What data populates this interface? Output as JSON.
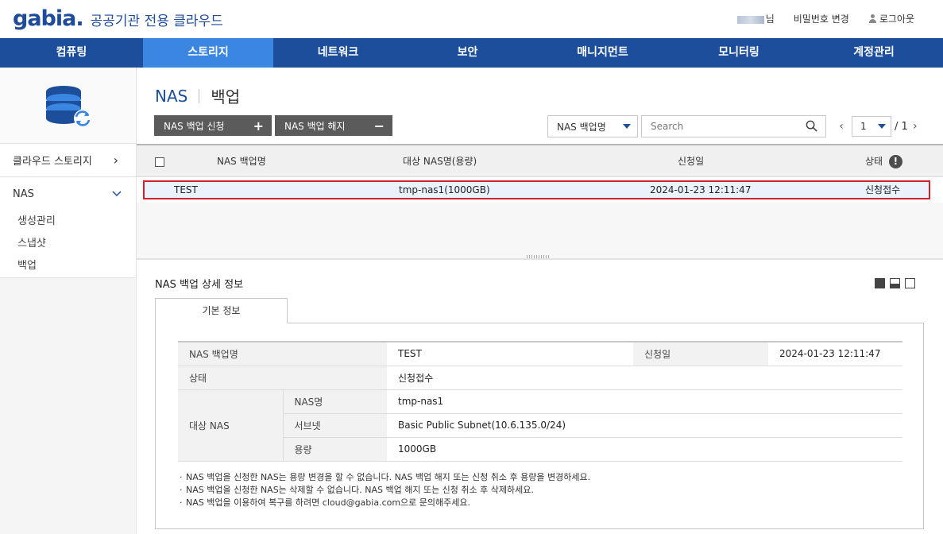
{
  "header": {
    "logo_word": "gabia",
    "logo_dot": ".",
    "logo_sub": "공공기관 전용 클라우드",
    "user_suffix": "님",
    "change_password": "비밀번호 변경",
    "logout": "로그아웃"
  },
  "gnb": [
    {
      "label": "컴퓨팅",
      "active": false
    },
    {
      "label": "스토리지",
      "active": true
    },
    {
      "label": "네트워크",
      "active": false
    },
    {
      "label": "보안",
      "active": false
    },
    {
      "label": "매니지먼트",
      "active": false
    },
    {
      "label": "모니터링",
      "active": false
    },
    {
      "label": "계정관리",
      "active": false
    }
  ],
  "sidebar": {
    "icon": "storage-sync-icon",
    "group_label": "클라우드 스토리지",
    "group_chevron": "›",
    "section_label": "NAS",
    "items": [
      {
        "label": "생성관리"
      },
      {
        "label": "스냅샷"
      },
      {
        "label": "백업"
      }
    ]
  },
  "page": {
    "title_main": "NAS",
    "title_sub": "백업",
    "btn_apply": "NAS 백업 신청",
    "btn_apply_sym": "+",
    "btn_cancel": "NAS 백업 해지",
    "btn_cancel_sym": "−",
    "filter_select": "NAS 백업명",
    "search_placeholder": "Search",
    "pager": {
      "current": "1",
      "total": "/ 1",
      "prev": "‹",
      "next": "›"
    }
  },
  "grid": {
    "columns": [
      "NAS 백업명",
      "대상 NAS명(용량)",
      "신청일",
      "상태"
    ],
    "status_info": "!",
    "rows": [
      {
        "name": "TEST",
        "target": "tmp-nas1(1000GB)",
        "date": "2024-01-23 12:11:47",
        "status": "신청접수"
      }
    ]
  },
  "detail": {
    "title": "NAS 백업 상세 정보",
    "tab": "기본 정보",
    "labels": {
      "backup_name": "NAS 백업명",
      "apply_date": "신청일",
      "status": "상태",
      "target_nas": "대상 NAS",
      "nas_name": "NAS명",
      "subnet": "서브넷",
      "capacity": "용량"
    },
    "values": {
      "backup_name": "TEST",
      "apply_date": "2024-01-23 12:11:47",
      "status": "신청접수",
      "nas_name": "tmp-nas1",
      "subnet": "Basic Public Subnet(10.6.135.0/24)",
      "capacity": "1000GB"
    },
    "notes": [
      "NAS 백업을 신청한 NAS는 용량 변경을 할 수 없습니다. NAS 백업 해지 또는 신청 취소 후 용량을 변경하세요.",
      "NAS 백업을 신청한 NAS는 삭제할 수 없습니다. NAS 백업 해지 또는 신청 취소 후 삭제하세요.",
      "NAS 백업을 이용하여 복구를 하려면 cloud@gabia.com으로 문의해주세요."
    ]
  },
  "colors": {
    "brand": "#1c4e9c",
    "nav_active": "#3a86e0",
    "selected_border": "#d0202a"
  }
}
